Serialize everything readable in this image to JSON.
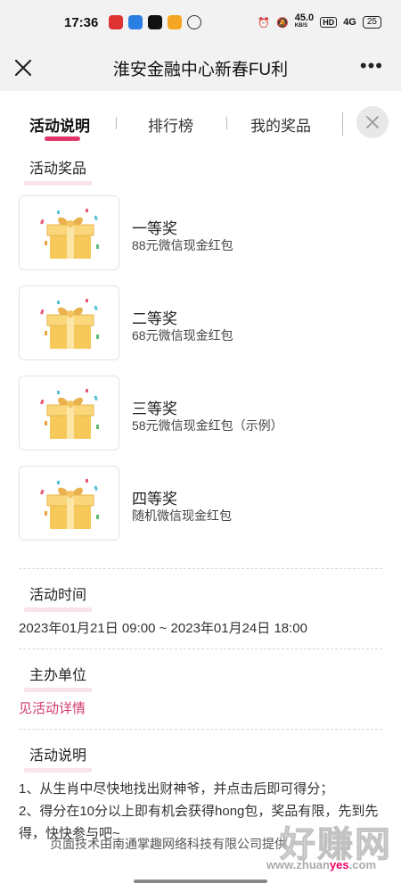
{
  "status_bar": {
    "time": "17:36",
    "net_speed": "45.0",
    "net_unit": "KB/S",
    "hd": "HD",
    "signal": "4G",
    "battery": "25"
  },
  "header": {
    "title": "淮安金融中心新春FU利",
    "more": "•••"
  },
  "tabs": [
    {
      "label": "活动说明",
      "active": true
    },
    {
      "label": "排行榜",
      "active": false
    },
    {
      "label": "我的奖品",
      "active": false
    }
  ],
  "prizes_section": {
    "title": "活动奖品",
    "items": [
      {
        "name": "一等奖",
        "desc": "88元微信现金红包"
      },
      {
        "name": "二等奖",
        "desc": "68元微信现金红包"
      },
      {
        "name": "三等奖",
        "desc": "58元微信现金红包（示例）"
      },
      {
        "name": "四等奖",
        "desc": "随机微信现金红包"
      }
    ]
  },
  "time_section": {
    "title": "活动时间",
    "value": "2023年01月21日 09:00 ~ 2023年01月24日 18:00"
  },
  "organizer_section": {
    "title": "主办单位",
    "link": "见活动详情"
  },
  "desc_section": {
    "title": "活动说明",
    "lines": [
      "1、从生肖中尽快地找出财神爷，并点击后即可得分；",
      "2、得分在10分以上即有机会获得hong包，奖品有限，先到先得，快快参与吧~"
    ]
  },
  "footer": "页面技术由南通掌趣网络科技有限公司提供",
  "watermark": {
    "big": "好赚网",
    "small_prefix": "www.zhuan",
    "small_highlight": "yes",
    "small_suffix": ".com"
  },
  "colors": {
    "accent": "#e0356b",
    "link": "#d23c6b",
    "section_underline": "#fbe3ea",
    "gift_box": "#f6c95a"
  }
}
